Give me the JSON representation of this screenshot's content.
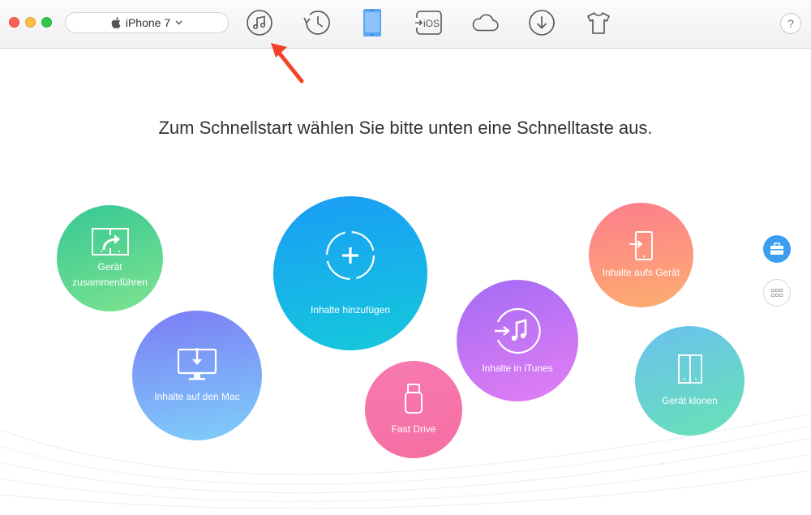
{
  "device_selector": {
    "device_name": "iPhone 7"
  },
  "toolbar": {
    "items": [
      {
        "icon": "music-note-icon",
        "label": ""
      },
      {
        "icon": "history-clock-icon",
        "label": ""
      },
      {
        "icon": "iphone-device-icon",
        "label": ""
      },
      {
        "icon": "to-ios-icon",
        "label": "iOS"
      },
      {
        "icon": "icloud-icon",
        "label": ""
      },
      {
        "icon": "download-icon",
        "label": ""
      },
      {
        "icon": "tshirt-icon",
        "label": ""
      }
    ],
    "help_label": "?"
  },
  "main": {
    "headline": "Zum Schnellstart wählen Sie bitte unten eine Schnelltaste aus.",
    "shortcuts": {
      "merge": {
        "label_line1": "Gerät",
        "label_line2": "zusammenführen"
      },
      "add": {
        "label": "Inhalte hinzufügen"
      },
      "mac": {
        "label": "Inhalte auf den Mac"
      },
      "itunes": {
        "label": "Inhalte in iTunes"
      },
      "drive": {
        "label": "Fast Drive"
      },
      "device": {
        "label": "Inhalte aufs Gerät"
      },
      "clone": {
        "label": "Gerät klonen"
      }
    }
  },
  "colors": {
    "accent_blue": "#3c9ef1",
    "annotation_arrow": "#f2432a"
  }
}
